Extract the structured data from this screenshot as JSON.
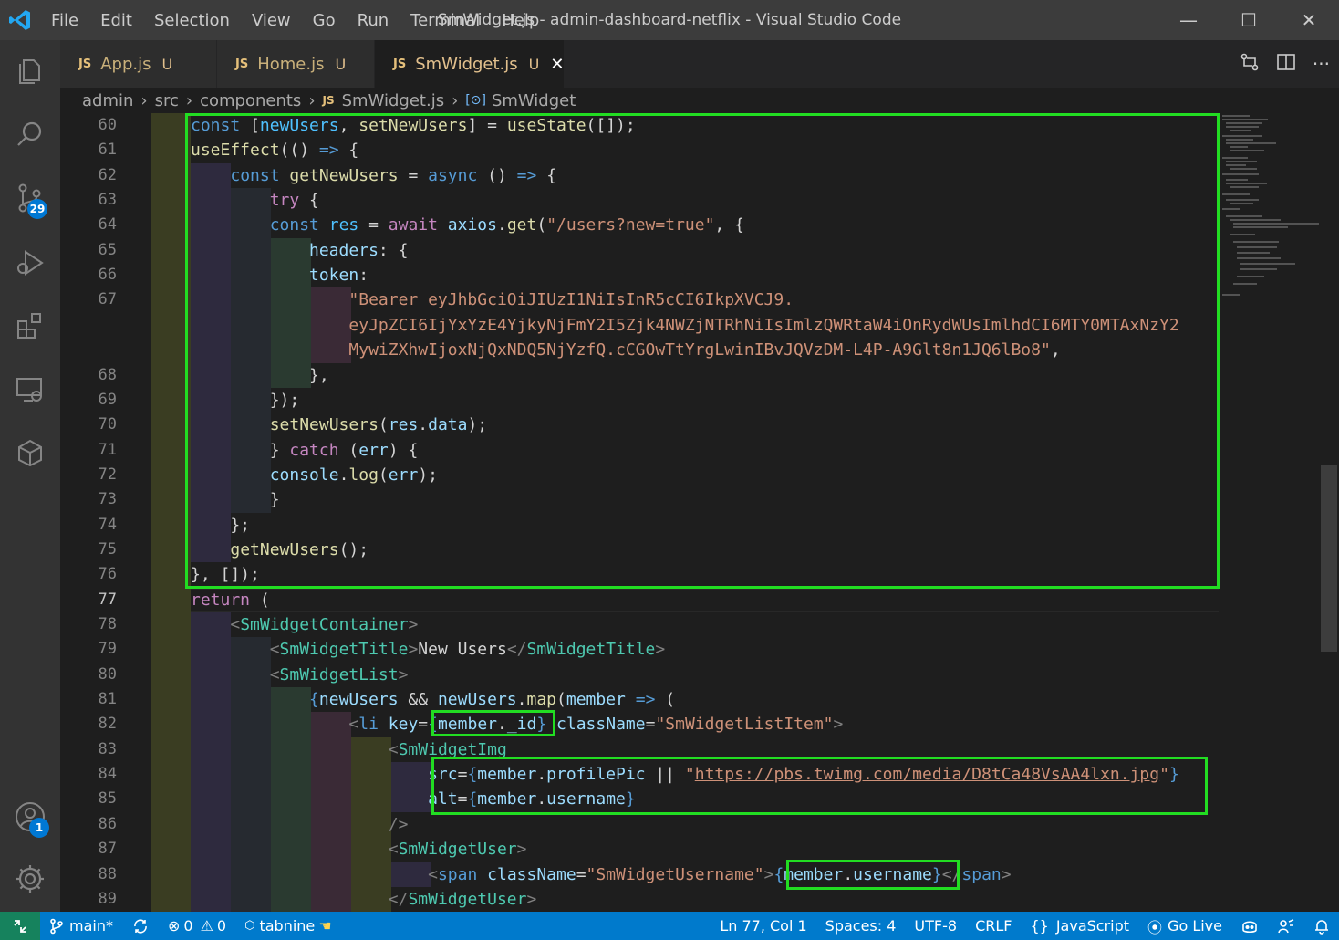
{
  "window": {
    "title": "SmWidget.js - admin-dashboard-netflix - Visual Studio Code",
    "menu": [
      "File",
      "Edit",
      "Selection",
      "View",
      "Go",
      "Run",
      "Terminal",
      "Help"
    ],
    "controls": {
      "minimize": "—",
      "maximize": "☐",
      "close": "✕"
    }
  },
  "activity_bar": {
    "items": [
      "explorer-icon",
      "search-icon",
      "source-control-icon",
      "run-debug-icon",
      "extensions-icon",
      "remote-explorer-icon",
      "testing-icon"
    ],
    "source_control_badge": "29",
    "accounts_badge": "1"
  },
  "tabs": [
    {
      "icon": "JS",
      "label": "App.js",
      "status": "U",
      "active": false
    },
    {
      "icon": "JS",
      "label": "Home.js",
      "status": "U",
      "active": false
    },
    {
      "icon": "JS",
      "label": "SmWidget.js",
      "status": "U",
      "active": true
    }
  ],
  "breadcrumb": {
    "parts": [
      "admin",
      "src",
      "components"
    ],
    "file_icon": "JS",
    "file": "SmWidget.js",
    "symbol": "SmWidget"
  },
  "editor": {
    "current_line": "77",
    "line_numbers": [
      "60",
      "61",
      "62",
      "63",
      "64",
      "65",
      "66",
      "67",
      "",
      "",
      "68",
      "69",
      "70",
      "71",
      "72",
      "73",
      "74",
      "75",
      "76",
      "77",
      "78",
      "79",
      "80",
      "81",
      "82",
      "83",
      "84",
      "85",
      "86",
      "87",
      "88",
      "89"
    ],
    "lines": [
      [
        [
          "kw",
          "const"
        ],
        [
          "p",
          " ["
        ],
        [
          "cst",
          "newUsers"
        ],
        [
          "p",
          ", "
        ],
        [
          "fn",
          "setNewUsers"
        ],
        [
          "p",
          "] = "
        ],
        [
          "fn",
          "useState"
        ],
        [
          "p",
          "([]);"
        ]
      ],
      [
        [
          "fn",
          "useEffect"
        ],
        [
          "p",
          "(() "
        ],
        [
          "kw",
          "=>"
        ],
        [
          "p",
          " {"
        ]
      ],
      [
        [
          "p",
          "    "
        ],
        [
          "kw",
          "const"
        ],
        [
          "p",
          " "
        ],
        [
          "fn",
          "getNewUsers"
        ],
        [
          "p",
          " = "
        ],
        [
          "kw",
          "async"
        ],
        [
          "p",
          " () "
        ],
        [
          "kw",
          "=>"
        ],
        [
          "p",
          " {"
        ]
      ],
      [
        [
          "p",
          "        "
        ],
        [
          "kc",
          "try"
        ],
        [
          "p",
          " {"
        ]
      ],
      [
        [
          "p",
          "        "
        ],
        [
          "kw",
          "const"
        ],
        [
          "p",
          " "
        ],
        [
          "cst",
          "res"
        ],
        [
          "p",
          " = "
        ],
        [
          "kc",
          "await"
        ],
        [
          "p",
          " "
        ],
        [
          "var",
          "axios"
        ],
        [
          "p",
          "."
        ],
        [
          "fn",
          "get"
        ],
        [
          "p",
          "("
        ],
        [
          "str",
          "\"/users?new=true\""
        ],
        [
          "p",
          ", {"
        ]
      ],
      [
        [
          "p",
          "            "
        ],
        [
          "var",
          "headers"
        ],
        [
          "p",
          ": {"
        ]
      ],
      [
        [
          "p",
          "            "
        ],
        [
          "var",
          "token"
        ],
        [
          "p",
          ":"
        ]
      ],
      [
        [
          "p",
          "                "
        ],
        [
          "str",
          "\"Bearer eyJhbGciOiJIUzI1NiIsInR5cCI6IkpXVCJ9."
        ]
      ],
      [
        [
          "p",
          "                "
        ],
        [
          "str",
          "eyJpZCI6IjYxYzE4YjkyNjFmY2I5Zjk4NWZjNTRhNiIsImlzQWRtaW4iOnRydWUsImlhdCI6MTY0MTAxNzY2"
        ]
      ],
      [
        [
          "p",
          "                "
        ],
        [
          "str",
          "MywiZXhwIjoxNjQxNDQ5NjYzfQ.cCGOwTtYrgLwinIBvJQVzDM-L4P-A9Glt8n1JQ6lBo8\""
        ],
        [
          "p",
          ","
        ]
      ],
      [
        [
          "p",
          "            },"
        ]
      ],
      [
        [
          "p",
          "        });"
        ]
      ],
      [
        [
          "p",
          "        "
        ],
        [
          "fn",
          "setNewUsers"
        ],
        [
          "p",
          "("
        ],
        [
          "var",
          "res"
        ],
        [
          "p",
          "."
        ],
        [
          "var",
          "data"
        ],
        [
          "p",
          ");"
        ]
      ],
      [
        [
          "p",
          "        } "
        ],
        [
          "kc",
          "catch"
        ],
        [
          "p",
          " ("
        ],
        [
          "var",
          "err"
        ],
        [
          "p",
          ") {"
        ]
      ],
      [
        [
          "p",
          "        "
        ],
        [
          "var",
          "console"
        ],
        [
          "p",
          "."
        ],
        [
          "fn",
          "log"
        ],
        [
          "p",
          "("
        ],
        [
          "var",
          "err"
        ],
        [
          "p",
          ");"
        ]
      ],
      [
        [
          "p",
          "        }"
        ]
      ],
      [
        [
          "p",
          "    };"
        ]
      ],
      [
        [
          "p",
          "    "
        ],
        [
          "fn",
          "getNewUsers"
        ],
        [
          "p",
          "();"
        ]
      ],
      [
        [
          "p",
          "}, []);"
        ]
      ],
      [
        [
          "kc",
          "return"
        ],
        [
          "p",
          " ("
        ]
      ],
      [
        [
          "p",
          "    "
        ],
        [
          "br",
          "<"
        ],
        [
          "tag",
          "SmWidgetContainer"
        ],
        [
          "br",
          ">"
        ]
      ],
      [
        [
          "p",
          "        "
        ],
        [
          "br",
          "<"
        ],
        [
          "tag",
          "SmWidgetTitle"
        ],
        [
          "br",
          ">"
        ],
        [
          "p",
          "New Users"
        ],
        [
          "br",
          "</"
        ],
        [
          "tag",
          "SmWidgetTitle"
        ],
        [
          "br",
          ">"
        ]
      ],
      [
        [
          "p",
          "        "
        ],
        [
          "br",
          "<"
        ],
        [
          "tag",
          "SmWidgetList"
        ],
        [
          "br",
          ">"
        ]
      ],
      [
        [
          "p",
          "            "
        ],
        [
          "jsxb",
          "{"
        ],
        [
          "var",
          "newUsers"
        ],
        [
          "p",
          " && "
        ],
        [
          "var",
          "newUsers"
        ],
        [
          "p",
          "."
        ],
        [
          "fn",
          "map"
        ],
        [
          "p",
          "("
        ],
        [
          "var",
          "member"
        ],
        [
          "p",
          " "
        ],
        [
          "kw",
          "=>"
        ],
        [
          "p",
          " ("
        ]
      ],
      [
        [
          "p",
          "                "
        ],
        [
          "br",
          "<"
        ],
        [
          "kw",
          "li"
        ],
        [
          "p",
          " "
        ],
        [
          "attr",
          "key"
        ],
        [
          "p",
          "="
        ],
        [
          "jsxb",
          "{"
        ],
        [
          "var",
          "member"
        ],
        [
          "p",
          "."
        ],
        [
          "var",
          "_id"
        ],
        [
          "jsxb",
          "}"
        ],
        [
          "p",
          " "
        ],
        [
          "attr",
          "className"
        ],
        [
          "p",
          "="
        ],
        [
          "str",
          "\"SmWidgetListItem\""
        ],
        [
          "br",
          ">"
        ]
      ],
      [
        [
          "p",
          "                    "
        ],
        [
          "br",
          "<"
        ],
        [
          "tag",
          "SmWidgetImg"
        ]
      ],
      [
        [
          "p",
          "                        "
        ],
        [
          "attr",
          "src"
        ],
        [
          "p",
          "="
        ],
        [
          "jsxb",
          "{"
        ],
        [
          "var",
          "member"
        ],
        [
          "p",
          "."
        ],
        [
          "var",
          "profilePic"
        ],
        [
          "p",
          " || "
        ],
        [
          "str",
          "\""
        ],
        [
          "url",
          "https://pbs.twimg.com/media/D8tCa48VsAA4lxn.jpg"
        ],
        [
          "str",
          "\""
        ],
        [
          "jsxb",
          "}"
        ]
      ],
      [
        [
          "p",
          "                        "
        ],
        [
          "attr",
          "alt"
        ],
        [
          "p",
          "="
        ],
        [
          "jsxb",
          "{"
        ],
        [
          "var",
          "member"
        ],
        [
          "p",
          "."
        ],
        [
          "var",
          "username"
        ],
        [
          "jsxb",
          "}"
        ]
      ],
      [
        [
          "p",
          "                    "
        ],
        [
          "br",
          "/>"
        ]
      ],
      [
        [
          "p",
          "                    "
        ],
        [
          "br",
          "<"
        ],
        [
          "tag",
          "SmWidgetUser"
        ],
        [
          "br",
          ">"
        ]
      ],
      [
        [
          "p",
          "                        "
        ],
        [
          "br",
          "<"
        ],
        [
          "kw",
          "span"
        ],
        [
          "p",
          " "
        ],
        [
          "attr",
          "className"
        ],
        [
          "p",
          "="
        ],
        [
          "str",
          "\"SmWidgetUsername\""
        ],
        [
          "br",
          ">"
        ],
        [
          "jsxb",
          "{"
        ],
        [
          "var",
          "member"
        ],
        [
          "p",
          "."
        ],
        [
          "var",
          "username"
        ],
        [
          "jsxb",
          "}"
        ],
        [
          "br",
          "</"
        ],
        [
          "kw",
          "span"
        ],
        [
          "br",
          ">"
        ]
      ],
      [
        [
          "p",
          "                    "
        ],
        [
          "br",
          "</"
        ],
        [
          "tag",
          "SmWidgetUser"
        ],
        [
          "br",
          ">"
        ]
      ]
    ]
  },
  "status_bar": {
    "branch": "main*",
    "errors": "0",
    "warnings": "0",
    "tabnine": "tabnine",
    "position": "Ln 77, Col 1",
    "spaces": "Spaces: 4",
    "encoding": "UTF-8",
    "eol": "CRLF",
    "language": "JavaScript",
    "live": "Go Live"
  }
}
